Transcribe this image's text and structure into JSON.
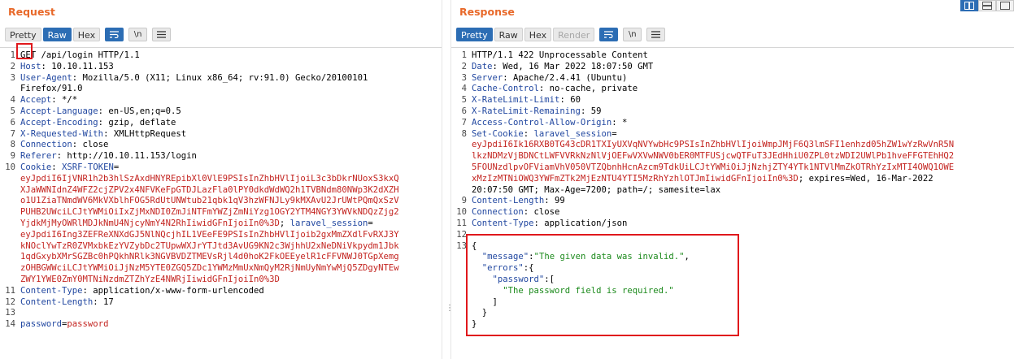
{
  "request": {
    "title": "Request",
    "tabs": [
      "Pretty",
      "Raw",
      "Hex"
    ],
    "active_tab": "Raw",
    "icons": [
      "wrap-lines-icon",
      "newline-icon",
      "menu-icon"
    ],
    "newline_label": "\\n",
    "lines": [
      {
        "n": "1",
        "parts": [
          [
            "GET",
            ""
          ],
          [
            " /api/login HTTP/1.1",
            ""
          ]
        ]
      },
      {
        "n": "2",
        "parts": [
          [
            "Host",
            "hname"
          ],
          [
            ": 10.10.11.153",
            ""
          ]
        ]
      },
      {
        "n": "3",
        "parts": [
          [
            "User-Agent",
            "hname"
          ],
          [
            ": Mozilla/5.0 (X11; Linux x86_64; rv:91.0) Gecko/20100101",
            ""
          ]
        ]
      },
      {
        "n": "",
        "parts": [
          [
            "Firefox/91.0",
            ""
          ]
        ]
      },
      {
        "n": "4",
        "parts": [
          [
            "Accept",
            "hname"
          ],
          [
            ": */*",
            ""
          ]
        ]
      },
      {
        "n": "5",
        "parts": [
          [
            "Accept-Language",
            "hname"
          ],
          [
            ": en-US,en;q=0.5",
            ""
          ]
        ]
      },
      {
        "n": "6",
        "parts": [
          [
            "Accept-Encoding",
            "hname"
          ],
          [
            ": gzip, deflate",
            ""
          ]
        ]
      },
      {
        "n": "7",
        "parts": [
          [
            "X-Requested-With",
            "hname"
          ],
          [
            ": XMLHttpRequest",
            ""
          ]
        ]
      },
      {
        "n": "8",
        "parts": [
          [
            "Connection",
            "hname"
          ],
          [
            ": close",
            ""
          ]
        ]
      },
      {
        "n": "9",
        "parts": [
          [
            "Referer",
            "hname"
          ],
          [
            ": http://10.10.11.153/login",
            ""
          ]
        ]
      },
      {
        "n": "10",
        "parts": [
          [
            "Cookie",
            "hname"
          ],
          [
            ": ",
            ""
          ],
          [
            "XSRF-TOKEN",
            "blue"
          ],
          [
            "=",
            ""
          ]
        ]
      },
      {
        "n": "",
        "parts": [
          [
            "eyJpdiI6IjVNR1h2b3hlSzAxdHNYREpibXl0VlE9PSIsInZhbHVlIjoiL3c3bDkrNUoxS3kxQ",
            "red"
          ]
        ]
      },
      {
        "n": "",
        "parts": [
          [
            "XJaWWNIdnZ4WFZ2cjZPV2x4NFVKeFpGTDJLazFla0lPY0dkdWdWQ2h1TVBNdm80NWp3K2dXZH",
            "red"
          ]
        ]
      },
      {
        "n": "",
        "parts": [
          [
            "o1U1ZiaTNmdWV6MkVXblhFOG5RdUtUNWtub21qbk1qV3hzWFNJLy9kMXAvU2JrUWtPQmQxSzV",
            "red"
          ]
        ]
      },
      {
        "n": "",
        "parts": [
          [
            "PUHB2UWciLCJtYWMiOiIxZjMxNDI0ZmJiNTFmYWZjZmNiYzg1OGY2YTM4NGY3YWVkNDQzZjg2",
            "red"
          ]
        ]
      },
      {
        "n": "",
        "parts": [
          [
            "YjdkMjMyOWRlMDJkNmU4NjcyNmY4N2RhIiwidGFnIjoiIn0%3D",
            "red"
          ],
          [
            "; ",
            ""
          ],
          [
            "laravel_session",
            "blue"
          ],
          [
            "=",
            ""
          ]
        ]
      },
      {
        "n": "",
        "parts": [
          [
            "eyJpdiI6Ing3ZEFReXNXdGJ5NlNQcjhIL1VEeFE9PSIsInZhbHVlIjoib2gxMmZXdlFvRXJ3Y",
            "red"
          ]
        ]
      },
      {
        "n": "",
        "parts": [
          [
            "kNOclYwTzR0ZVMxbkEzYVZybDc2TUpwWXJrYTJtd3AvUG9KN2c3WjhhU2xNeDNiVkpydm1Jbk",
            "red"
          ]
        ]
      },
      {
        "n": "",
        "parts": [
          [
            "1qdGxybXMrSGZBc0hPQkhNRlk3NGVBVDZTMEVsRjl4d0hoK2FkOEEyelR1cFFVNWJ0TGpXemg",
            "red"
          ]
        ]
      },
      {
        "n": "",
        "parts": [
          [
            "zOHBGWWciLCJtYWMiOiJjNzM5YTE0ZGQ5ZDc1YWMzMmUxNmQyM2RjNmUyNmYwMjQ5ZDgyNTEw",
            "red"
          ]
        ]
      },
      {
        "n": "",
        "parts": [
          [
            "ZWY1YWE0ZmY0MTNiNzdmZTZhYzE4NWRjIiwidGFnIjoiIn0%3D",
            "red"
          ]
        ]
      },
      {
        "n": "11",
        "parts": [
          [
            "Content-Type",
            "hname"
          ],
          [
            ": application/x-www-form-urlencoded",
            ""
          ]
        ]
      },
      {
        "n": "12",
        "parts": [
          [
            "Content-Length",
            "hname"
          ],
          [
            ": 17",
            ""
          ]
        ]
      },
      {
        "n": "13",
        "parts": [
          [
            "",
            ""
          ]
        ]
      },
      {
        "n": "14",
        "parts": [
          [
            "password",
            "blue"
          ],
          [
            "=",
            ""
          ],
          [
            "password",
            "red"
          ]
        ]
      }
    ]
  },
  "response": {
    "title": "Response",
    "tabs": [
      "Pretty",
      "Raw",
      "Hex",
      "Render"
    ],
    "active_tab": "Pretty",
    "disabled_tab": "Render",
    "icons": [
      "wrap-lines-icon",
      "newline-icon",
      "menu-icon"
    ],
    "newline_label": "\\n",
    "lines": [
      {
        "n": "1",
        "parts": [
          [
            "HTTP/1.1 422 Unprocessable Content",
            ""
          ]
        ]
      },
      {
        "n": "2",
        "parts": [
          [
            "Date",
            "hname"
          ],
          [
            ": Wed, 16 Mar 2022 18:07:50 GMT",
            ""
          ]
        ]
      },
      {
        "n": "3",
        "parts": [
          [
            "Server",
            "hname"
          ],
          [
            ": Apache/2.4.41 (Ubuntu)",
            ""
          ]
        ]
      },
      {
        "n": "4",
        "parts": [
          [
            "Cache-Control",
            "hname"
          ],
          [
            ": no-cache, private",
            ""
          ]
        ]
      },
      {
        "n": "5",
        "parts": [
          [
            "X-RateLimit-Limit",
            "hname"
          ],
          [
            ": 60",
            ""
          ]
        ]
      },
      {
        "n": "6",
        "parts": [
          [
            "X-RateLimit-Remaining",
            "hname"
          ],
          [
            ": 59",
            ""
          ]
        ]
      },
      {
        "n": "7",
        "parts": [
          [
            "Access-Control-Allow-Origin",
            "hname"
          ],
          [
            ": *",
            ""
          ]
        ]
      },
      {
        "n": "8",
        "parts": [
          [
            "Set-Cookie",
            "hname"
          ],
          [
            ": ",
            ""
          ],
          [
            "laravel_session",
            "blue"
          ],
          [
            "=",
            ""
          ]
        ]
      },
      {
        "n": "",
        "parts": [
          [
            "eyJpdiI6Ik16RXB0TG43cDR1TXIyUXVqNVYwbHc9PSIsInZhbHVlIjoiWmpJMjF6Q3lmSFI1enhzd05hZW1wYzRwVnR5N",
            "red"
          ]
        ]
      },
      {
        "n": "",
        "parts": [
          [
            "lkzNDMzVjBDNCtLWFVVRkNzNlVjOEFwVXVwNWV0bER0MTFUSjcwQTFuT3JEdHhiU0ZPL0tzWDI2UWlPb1hveFFGTEhHQ2",
            "red"
          ]
        ]
      },
      {
        "n": "",
        "parts": [
          [
            "5FOUNzdlpvOFViamVhV050VTZQbnhHcnAzcm9TdkUiLCJtYWMiOiJjNzhjZTY4YTk1NTVlMmZkOTRhYzIxMTI4OWQ1OWE",
            "red"
          ]
        ]
      },
      {
        "n": "",
        "parts": [
          [
            "xMzIzMTNiOWQ3YWFmZTk2MjEzNTU4YTI5MzRhYzhlOTJmIiwidGFnIjoiIn0%3D",
            "red"
          ],
          [
            "; expires=Wed, 16-Mar-2022",
            ""
          ]
        ]
      },
      {
        "n": "",
        "parts": [
          [
            "20:07:50 GMT; Max-Age=7200; path=/; samesite=lax",
            ""
          ]
        ]
      },
      {
        "n": "9",
        "parts": [
          [
            "Content-Length",
            "hname"
          ],
          [
            ": 99",
            ""
          ]
        ]
      },
      {
        "n": "10",
        "parts": [
          [
            "Connection",
            "hname"
          ],
          [
            ": close",
            ""
          ]
        ]
      },
      {
        "n": "11",
        "parts": [
          [
            "Content-Type",
            "hname"
          ],
          [
            ": application/json",
            ""
          ]
        ]
      },
      {
        "n": "12",
        "parts": [
          [
            "",
            ""
          ]
        ]
      },
      {
        "n": "13",
        "parts": [
          [
            "{",
            ""
          ]
        ]
      },
      {
        "n": "",
        "parts": [
          [
            "  \"message\"",
            "blue"
          ],
          [
            ":",
            ""
          ],
          [
            "\"The given data was invalid.\"",
            "green"
          ],
          [
            ",",
            ""
          ]
        ]
      },
      {
        "n": "",
        "parts": [
          [
            "  \"errors\"",
            "blue"
          ],
          [
            ":{",
            ""
          ]
        ]
      },
      {
        "n": "",
        "parts": [
          [
            "    \"password\"",
            "blue"
          ],
          [
            ":[",
            ""
          ]
        ]
      },
      {
        "n": "",
        "parts": [
          [
            "      \"The password field is required.\"",
            "green"
          ]
        ]
      },
      {
        "n": "",
        "parts": [
          [
            "    ]",
            ""
          ]
        ]
      },
      {
        "n": "",
        "parts": [
          [
            "  }",
            ""
          ]
        ]
      },
      {
        "n": "",
        "parts": [
          [
            "}",
            ""
          ]
        ]
      }
    ]
  }
}
